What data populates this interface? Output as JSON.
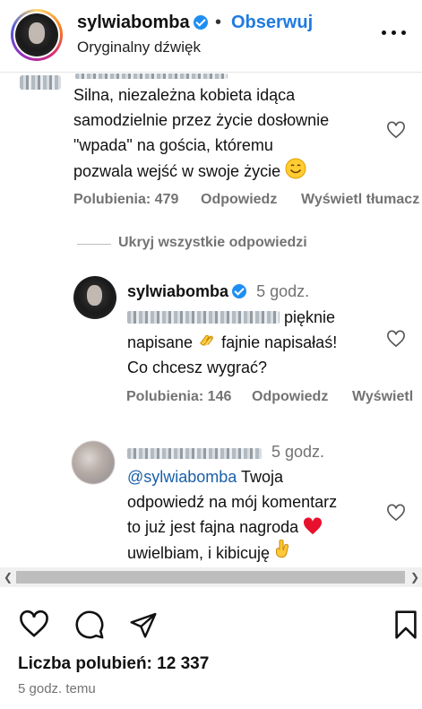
{
  "header": {
    "username": "sylwiabomba",
    "separator": "•",
    "follow_label": "Obserwuj",
    "subtitle": "Oryginalny dźwięk",
    "more_icon": "more-options-icon"
  },
  "comment1": {
    "lines": [
      "Silna, niezależna kobieta idąca",
      "samodzielnie przez życie dosłownie",
      "\"wpada\" na gościa, któremu",
      "pozwala wejść w swoje życie"
    ],
    "emoji": "smiling-face-icon",
    "likes": "Polubienia: 479",
    "reply_label": "Odpowiedz",
    "translate_label": "Wyświetl tłumacz"
  },
  "hide_replies_label": "Ukryj wszystkie odpowiedzi",
  "reply1": {
    "username": "sylwiabomba",
    "time": "5 godz.",
    "line1_suffix": "pięknie",
    "line2_a": "napisane",
    "line2_b": "fajnie napisałaś!",
    "line3": "Co chcesz wygrać?",
    "emoji": "clapping-hands-icon",
    "likes": "Polubienia: 146",
    "reply_label": "Odpowiedz",
    "translate_label": "Wyświetl"
  },
  "reply2": {
    "time": "5 godz.",
    "mention": "@sylwiabomba",
    "line1_rest": " Twoja",
    "line2": "odpowiedź na mój komentarz",
    "line3": "to już jest fajna nagroda",
    "line4": "uwielbiam, i kibicuję",
    "emoji_heart": "red-heart-icon",
    "emoji_fingers": "crossed-fingers-icon"
  },
  "footer": {
    "likes_text": "Liczba polubień: 12 337",
    "time_ago": "5 godz. temu"
  },
  "colors": {
    "accent": "#1f7be0",
    "verified": "#1f8ef1",
    "meta_gray": "#737373"
  }
}
